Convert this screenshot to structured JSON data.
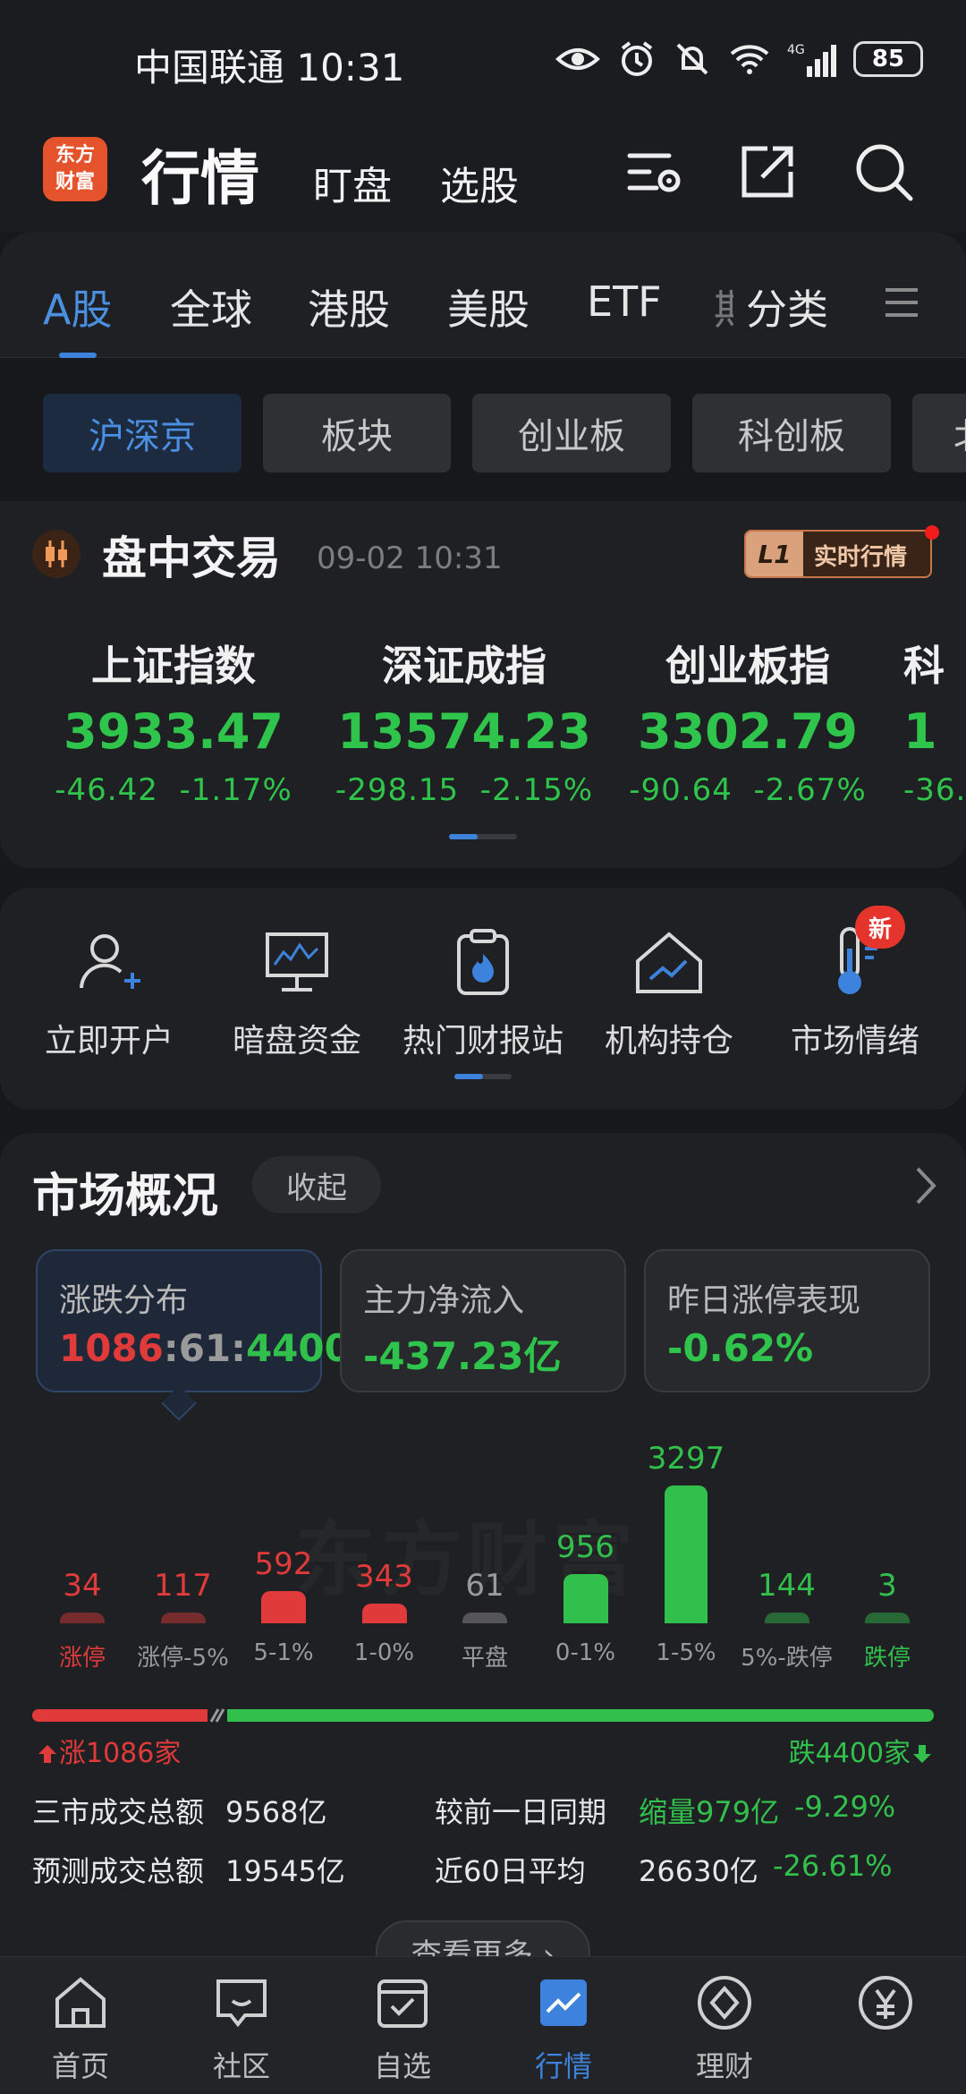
{
  "status_bar": {
    "carrier_time": "中国联通 10:31",
    "network": "4G",
    "battery": "85"
  },
  "header": {
    "logo_line1": "东方",
    "logo_line2": "财富",
    "title": "行情",
    "link1": "盯盘",
    "link2": "选股",
    "icons": [
      "filter-settings-icon",
      "share-icon",
      "search-icon"
    ]
  },
  "market_tabs": [
    "A股",
    "全球",
    "港股",
    "美股",
    "ETF",
    "期",
    "分类"
  ],
  "sub_tabs": [
    "沪深京",
    "板块",
    "创业板",
    "科创板",
    "北"
  ],
  "trading": {
    "title": "盘中交易",
    "time": "09-02 10:31",
    "badge_level": "L1",
    "badge_text": "实时行情"
  },
  "indices": [
    {
      "name": "上证指数",
      "value": "3933.47",
      "change": "-46.42",
      "pct": "-1.17%"
    },
    {
      "name": "深证成指",
      "value": "13574.23",
      "change": "-298.15",
      "pct": "-2.15%"
    },
    {
      "name": "创业板指",
      "value": "3302.79",
      "change": "-90.64",
      "pct": "-2.67%"
    },
    {
      "name": "科",
      "value": "1",
      "change": "-36.",
      "pct": ""
    }
  ],
  "shortcuts": [
    {
      "label": "立即开户",
      "icon": "add-user-icon"
    },
    {
      "label": "暗盘资金",
      "icon": "monitor-chart-icon"
    },
    {
      "label": "热门财报站",
      "icon": "clipboard-fire-icon"
    },
    {
      "label": "机构持仓",
      "icon": "house-chart-icon"
    },
    {
      "label": "市场情绪",
      "icon": "thermometer-icon"
    }
  ],
  "new_badge": "新",
  "overview": {
    "title": "市场概况",
    "collapse": "收起",
    "stats": [
      {
        "label": "涨跌分布",
        "up": "1086",
        "flat": "61",
        "down": "4400"
      },
      {
        "label": "主力净流入",
        "value": "-437.23亿"
      },
      {
        "label": "昨日涨停表现",
        "value": "-0.62%"
      }
    ],
    "watermark": "东方财富"
  },
  "chart_data": {
    "type": "bar",
    "categories": [
      "涨停",
      "涨停-5%",
      "5-1%",
      "1-0%",
      "平盘",
      "0-1%",
      "1-5%",
      "5%-跌停",
      "跌停"
    ],
    "values": [
      34,
      117,
      592,
      343,
      61,
      956,
      3297,
      144,
      3
    ],
    "colors": [
      "#e03a3a",
      "#e03a3a",
      "#e03a3a",
      "#e03a3a",
      "#9a9a9a",
      "#32c04c",
      "#32c04c",
      "#32c04c",
      "#32c04c"
    ]
  },
  "ratio": {
    "up_label": "涨1086家",
    "down_label": "跌4400家",
    "up": 1086,
    "down": 4400
  },
  "turnover": {
    "total_label": "三市成交总额",
    "total_value": "9568亿",
    "compare_label": "较前一日同期",
    "compare_value": "缩量979亿",
    "compare_pct": "-9.29%",
    "forecast_label": "预测成交总额",
    "forecast_value": "19545亿",
    "avg_label": "近60日平均",
    "avg_value": "26630亿",
    "avg_pct": "-26.61%"
  },
  "more_button": "查看更多 ›",
  "bottom_nav": [
    {
      "label": "首页",
      "icon": "home-icon"
    },
    {
      "label": "社区",
      "icon": "chat-icon"
    },
    {
      "label": "自选",
      "icon": "watchlist-icon"
    },
    {
      "label": "行情",
      "icon": "market-chart-icon"
    },
    {
      "label": "理财",
      "icon": "diamond-icon"
    },
    {
      "label": "",
      "icon": "yuan-icon"
    }
  ]
}
